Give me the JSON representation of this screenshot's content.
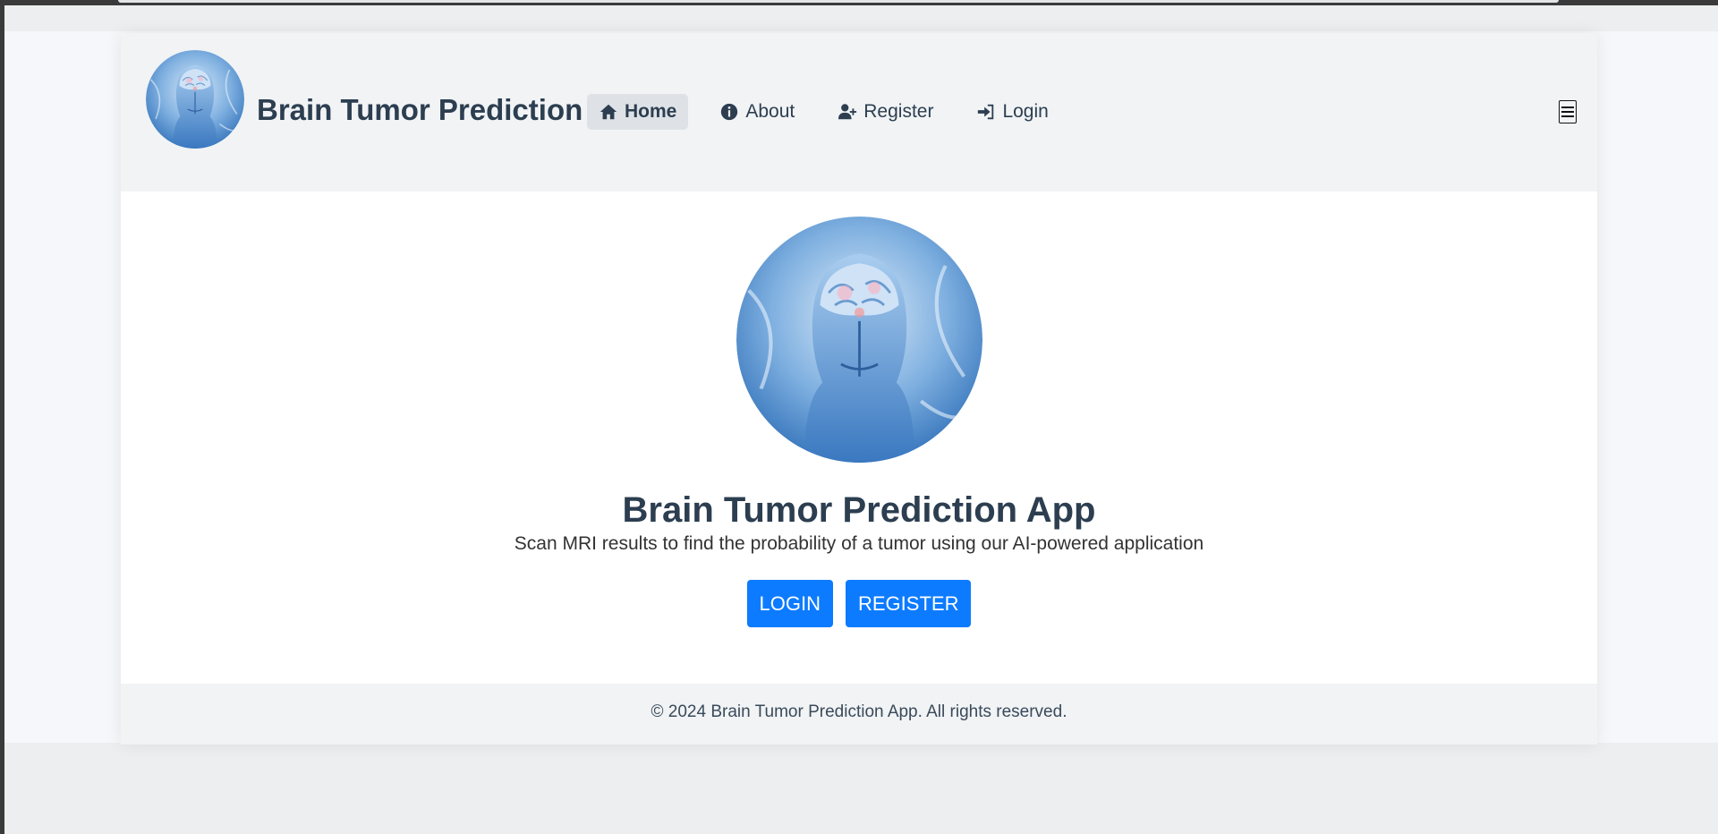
{
  "header": {
    "brand": "Brain Tumor Prediction",
    "logo_icon": "brain-head-logo",
    "nav": [
      {
        "label": "Home",
        "icon": "home-icon",
        "active": true
      },
      {
        "label": "About",
        "icon": "info-icon",
        "active": false
      },
      {
        "label": "Register",
        "icon": "user-plus-icon",
        "active": false
      },
      {
        "label": "Login",
        "icon": "sign-in-icon",
        "active": false
      }
    ],
    "menu_icon": "hamburger-icon"
  },
  "hero": {
    "title": "Brain Tumor Prediction App",
    "subtitle": "Scan MRI results to find the probability of a tumor using our AI-powered application",
    "login_label": "LOGIN",
    "register_label": "REGISTER"
  },
  "footer": {
    "text": "© 2024 Brain Tumor Prediction App. All rights reserved."
  },
  "colors": {
    "primary": "#0d7bff",
    "heading": "#2c3e50",
    "navbar_bg": "#f1f3f5"
  }
}
